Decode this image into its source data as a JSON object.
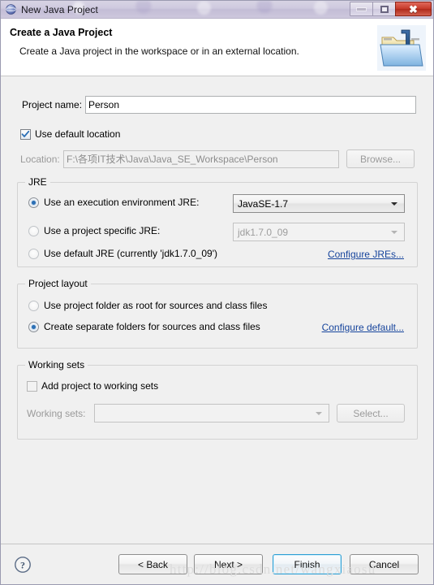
{
  "window": {
    "title": "New Java Project",
    "icon": "java-globe-icon",
    "controls": {
      "minimize": "minimize-icon",
      "maximize": "maximize-icon",
      "close": "close-icon"
    }
  },
  "header": {
    "title": "Create a Java Project",
    "description": "Create a Java project in the workspace or in an external location.",
    "icon": "java-project-folder-icon"
  },
  "project": {
    "name_label": "Project name:",
    "name_value": "Person",
    "use_default_location_label": "Use default location",
    "use_default_location_checked": true,
    "location_label": "Location:",
    "location_value": "F:\\各项IT技术\\Java\\Java_SE_Workspace\\Person",
    "browse_label": "Browse..."
  },
  "jre": {
    "group_title": "JRE",
    "options": [
      {
        "label": "Use an execution environment JRE:",
        "selected": true,
        "value": "JavaSE-1.7",
        "enabled": true
      },
      {
        "label": "Use a project specific JRE:",
        "selected": false,
        "value": "jdk1.7.0_09",
        "enabled": false
      },
      {
        "label": "Use default JRE (currently 'jdk1.7.0_09')",
        "selected": false
      }
    ],
    "configure_link": "Configure JREs..."
  },
  "project_layout": {
    "group_title": "Project layout",
    "options": [
      {
        "label": "Use project folder as root for sources and class files",
        "selected": false
      },
      {
        "label": "Create separate folders for sources and class files",
        "selected": true
      }
    ],
    "configure_link": "Configure default..."
  },
  "working_sets": {
    "group_title": "Working sets",
    "add_label": "Add project to working sets",
    "add_checked": false,
    "sets_label": "Working sets:",
    "sets_value": "",
    "select_label": "Select..."
  },
  "footer": {
    "help_icon": "help-question-icon",
    "back_label": "< Back",
    "next_label": "Next >",
    "finish_label": "Finish",
    "cancel_label": "Cancel"
  },
  "watermark": "http://blog.csdn.net/wangxiaosu",
  "colors": {
    "dialog_background": "#f0f0f0",
    "header_background": "#ffffff",
    "link": "#16449c",
    "radio_selected": "#2b6fb5",
    "close_button": "#c63a2a",
    "default_button_border": "#2e9fd4"
  }
}
